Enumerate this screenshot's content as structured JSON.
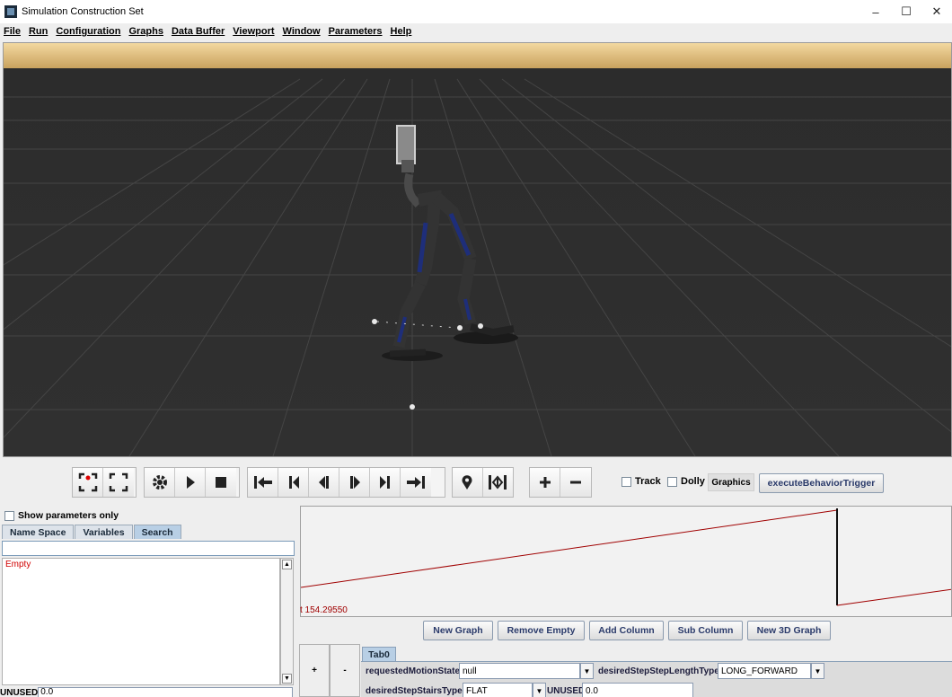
{
  "window": {
    "title": "Simulation Construction Set"
  },
  "menu": [
    "File",
    "Run",
    "Configuration",
    "Graphs",
    "Data Buffer",
    "Viewport",
    "Window",
    "Parameters",
    "Help"
  ],
  "toolbar": {
    "track_label": "Track",
    "dolly_label": "Dolly",
    "graphics_label": "Graphics",
    "execute_label": "executeBehaviorTrigger"
  },
  "left_panel": {
    "show_params_label": "Show parameters only",
    "tabs": [
      "Name Space",
      "Variables",
      "Search"
    ],
    "active_tab": "Search",
    "search_value": "",
    "results_empty": "Empty",
    "unused_label": "UNUSED",
    "unused_value": "0.0"
  },
  "graph": {
    "time_label": "t  154.29550"
  },
  "graph_buttons": [
    "New Graph",
    "Remove Empty",
    "Add Column",
    "Sub Column",
    "New 3D Graph"
  ],
  "plus_label": "+",
  "minus_label": "-",
  "tab0_label": "Tab0",
  "params": {
    "requested_motion_state_label": "requestedMotionState",
    "requested_motion_state_value": "null",
    "step_length_type_label": "desiredStepStepLengthType",
    "step_length_type_value": "LONG_FORWARD",
    "stairs_type_label": "desiredStepStairsType",
    "stairs_type_value": "FLAT",
    "unused_label": "UNUSED",
    "unused_value": "0.0"
  },
  "colors": {
    "viewport_bg": "#2a2a2a",
    "sky_band": "#f0d090",
    "graph_line": "#a00000",
    "active_tab": "#b8cfe5"
  }
}
